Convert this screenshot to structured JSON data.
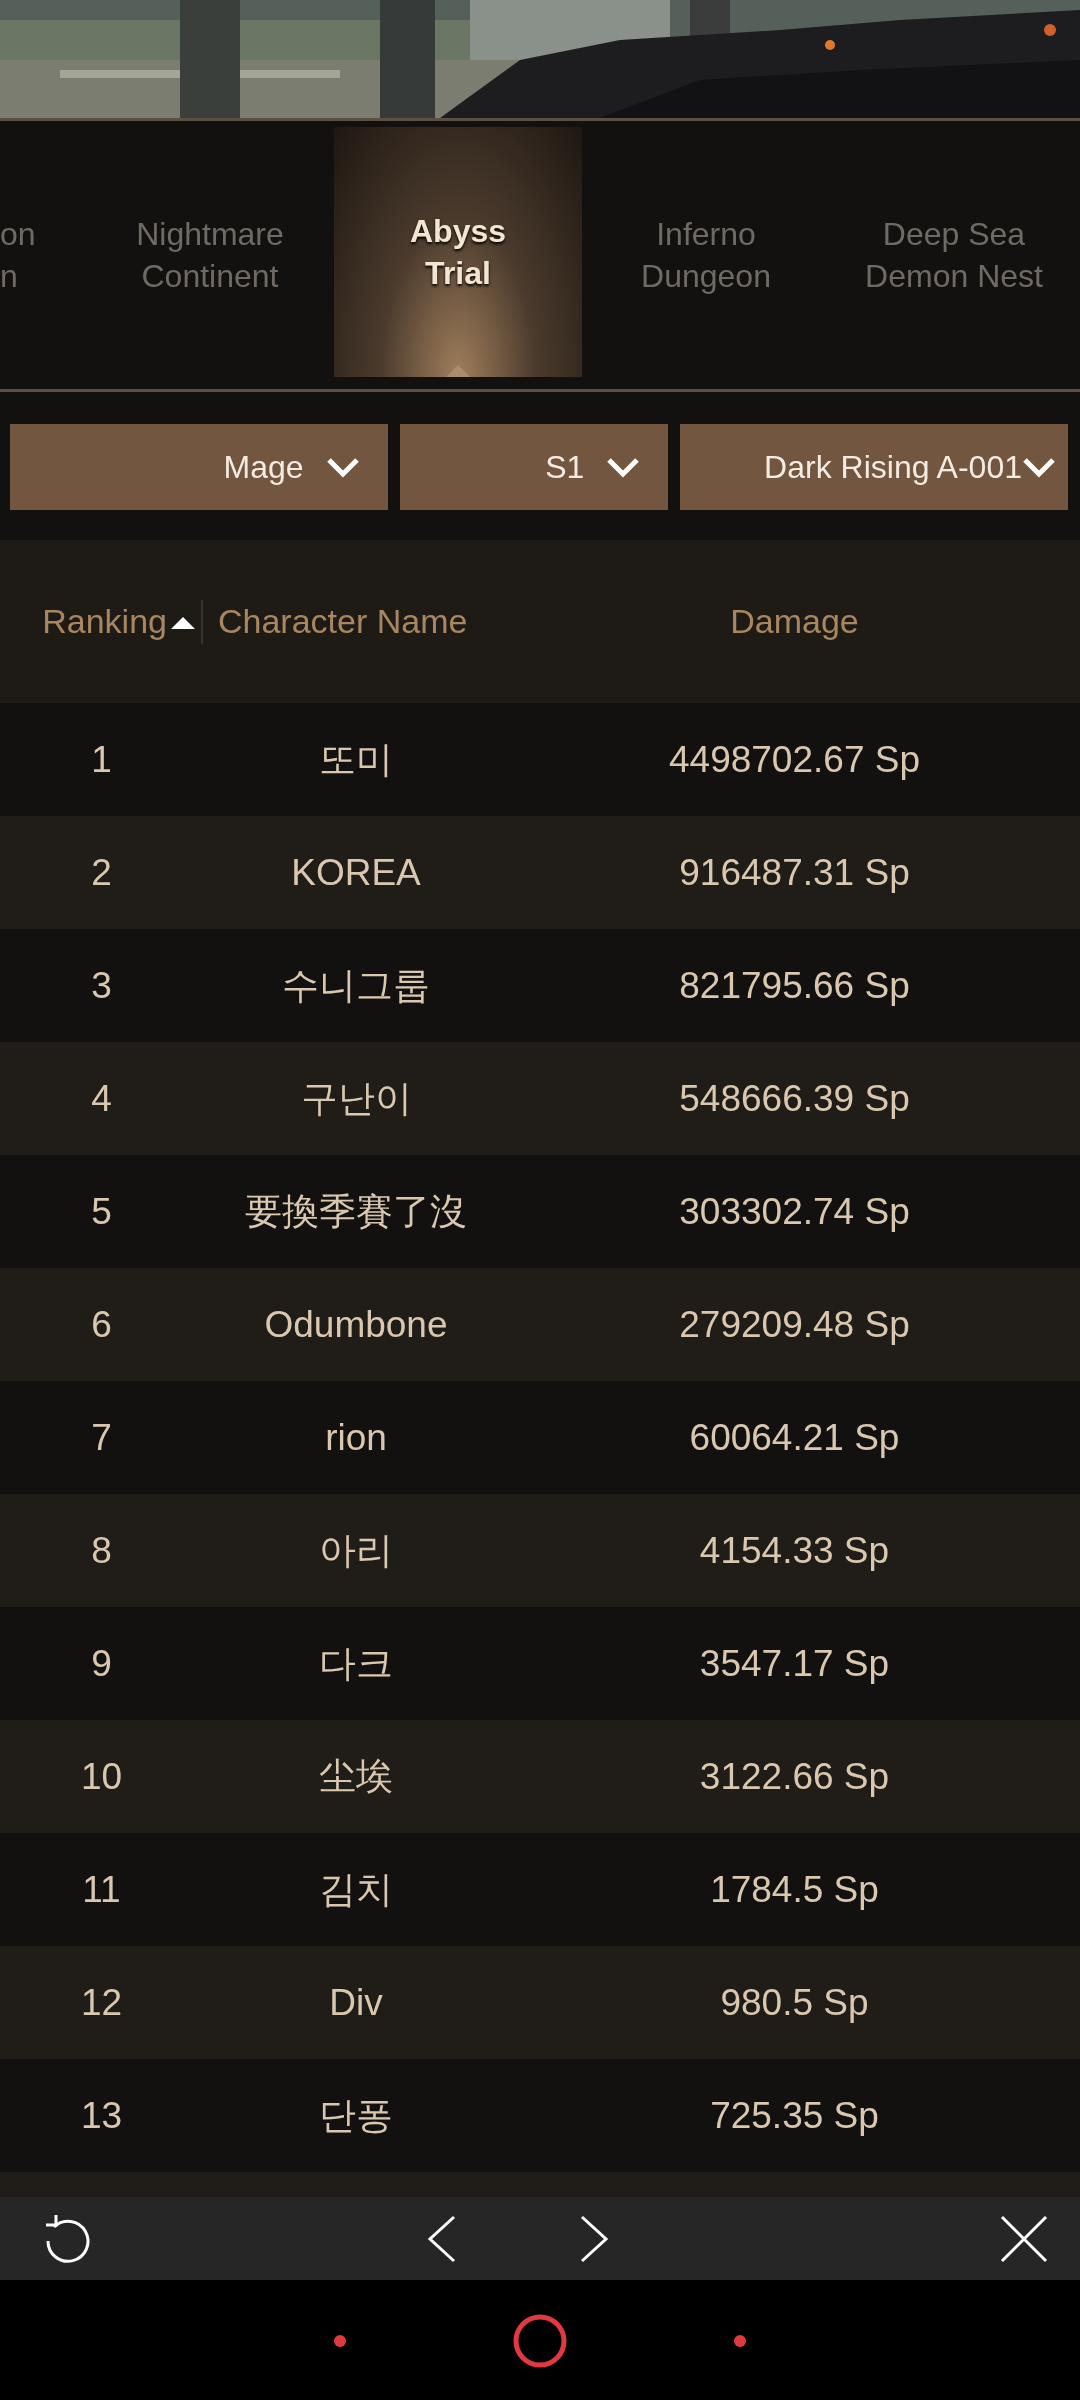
{
  "tabs": [
    {
      "lines": [
        "on",
        "n"
      ],
      "selected": false
    },
    {
      "lines": [
        "Nightmare",
        "Continent"
      ],
      "selected": false
    },
    {
      "lines": [
        "Abyss",
        "Trial"
      ],
      "selected": true
    },
    {
      "lines": [
        "Inferno",
        "Dungeon"
      ],
      "selected": false
    },
    {
      "lines": [
        "Deep Sea",
        "Demon Nest"
      ],
      "selected": false
    }
  ],
  "filters": [
    "Mage",
    "S1",
    "Dark Rising A-001"
  ],
  "table": {
    "columns": [
      "Ranking",
      "Character Name",
      "Damage"
    ],
    "rows": [
      [
        "1",
        "또미",
        "4498702.67 Sp"
      ],
      [
        "2",
        "KOREA",
        "916487.31 Sp"
      ],
      [
        "3",
        "수니그룹",
        "821795.66 Sp"
      ],
      [
        "4",
        "구난이",
        "548666.39 Sp"
      ],
      [
        "5",
        "要換季賽了沒",
        "303302.74 Sp"
      ],
      [
        "6",
        "Odumbone",
        "279209.48 Sp"
      ],
      [
        "7",
        "rion",
        "60064.21 Sp"
      ],
      [
        "8",
        "아리",
        "4154.33 Sp"
      ],
      [
        "9",
        "다크",
        "3547.17 Sp"
      ],
      [
        "10",
        "尘埃",
        "3122.66 Sp"
      ],
      [
        "11",
        "김치",
        "1784.5 Sp"
      ],
      [
        "12",
        "Div",
        "980.5 Sp"
      ],
      [
        "13",
        "단퐁",
        "725.35 Sp"
      ]
    ]
  }
}
